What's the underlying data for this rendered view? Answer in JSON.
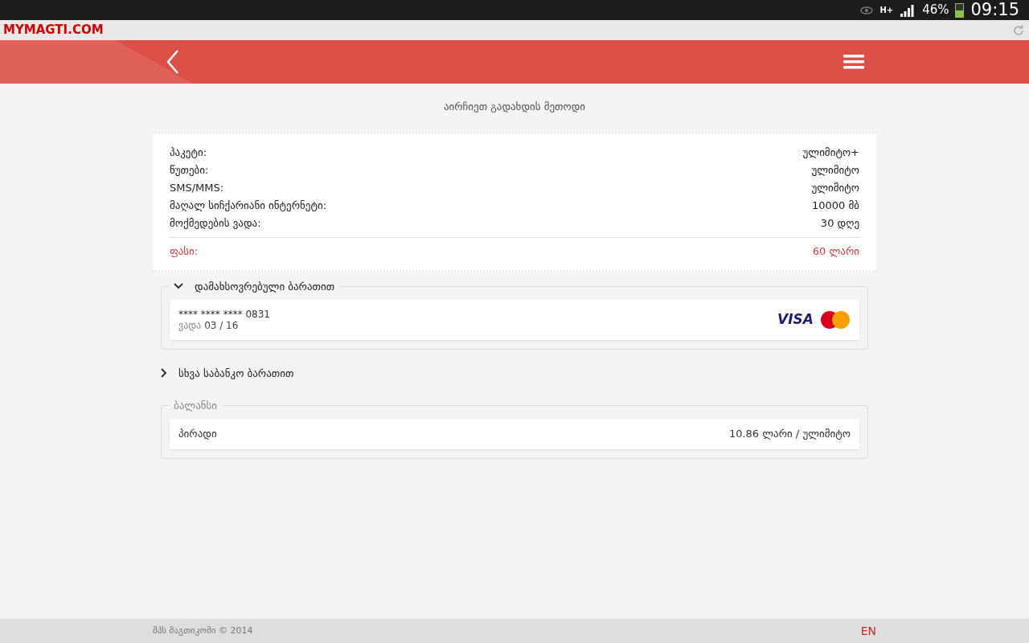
{
  "status_bar": {
    "network": "H+",
    "battery": "46%",
    "time": "09:15"
  },
  "browser": {
    "url": "MYMAGTI.COM"
  },
  "page": {
    "title": "აირჩიეთ გადახდის მეთოდი"
  },
  "package": {
    "rows": [
      {
        "label": "პაკეტი:",
        "value": "ულიმიტო+"
      },
      {
        "label": "წუთები:",
        "value": "ულიმიტო"
      },
      {
        "label": "SMS/MMS:",
        "value": "ულიმიტო"
      },
      {
        "label": "მაღალ სიჩქარიანი ინტერნეტი:",
        "value": "10000 მბ"
      },
      {
        "label": "მოქმედების ვადა:",
        "value": "30 დღე"
      }
    ],
    "price": {
      "label": "ფასი:",
      "value": "60 ლარი"
    }
  },
  "payment_methods": [
    {
      "kind": "saved_card",
      "title": "დამახსოვრებული ბარათით",
      "expanded": true,
      "card": {
        "number": "**** **** **** 0831",
        "expiry_label": "ვადა",
        "expiry": "03 / 16",
        "brand": "VISA"
      }
    },
    {
      "kind": "new_card",
      "title": "სხვა საბანკო ბარათით",
      "expanded": false
    },
    {
      "kind": "balance",
      "title": "ბალანსი",
      "account": {
        "name": "პირადი",
        "amount": "10.86 ლარი / ულიმიტო"
      }
    }
  ],
  "footer": {
    "copyright": "შპს მაგთიკომი © 2014",
    "language": "EN"
  }
}
